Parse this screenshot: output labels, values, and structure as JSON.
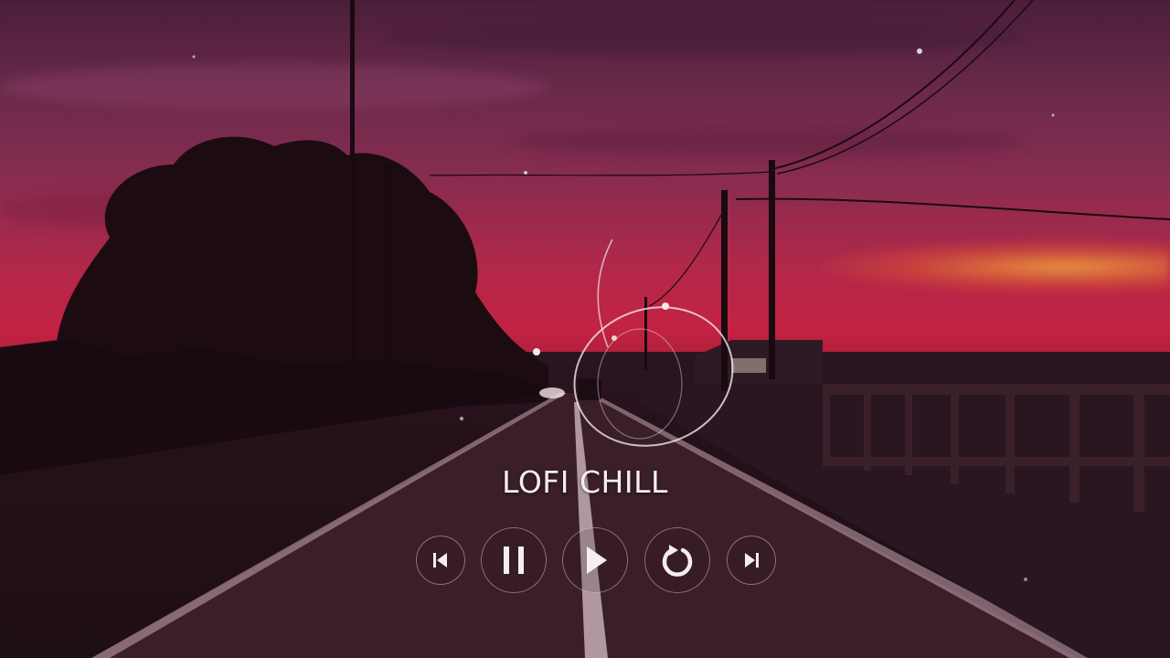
{
  "player": {
    "title": "LOFI CHILL"
  },
  "controls": {
    "buttons": [
      {
        "name": "previous-button",
        "icon": "skip-previous-icon"
      },
      {
        "name": "pause-button",
        "icon": "pause-icon"
      },
      {
        "name": "play-button",
        "icon": "play-icon"
      },
      {
        "name": "replay-button",
        "icon": "replay-icon"
      },
      {
        "name": "next-button",
        "icon": "skip-next-icon"
      }
    ]
  },
  "colors": {
    "sky_top": "#4a1e3a",
    "sky_red": "#c42242",
    "horizon_glow": "#f0a03c",
    "text": "#f4eef0"
  }
}
